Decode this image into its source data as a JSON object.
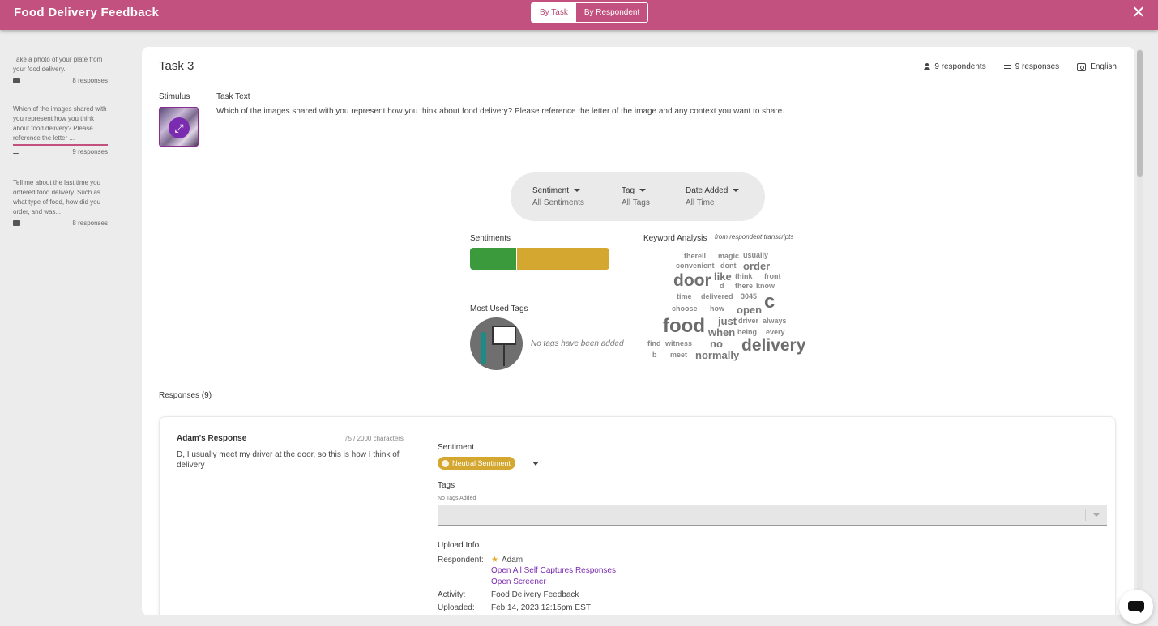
{
  "header": {
    "title": "Food Delivery Feedback",
    "toggle_by_task": "By Task",
    "toggle_by_respondent": "By Respondent",
    "close_icon": "close-icon"
  },
  "sidebar": {
    "items": [
      {
        "question": "Take a photo of your plate from your food delivery.",
        "icon": "camera-icon",
        "responses": "8 responses"
      },
      {
        "question": "Which of the images shared with you represent how you think about food delivery? Please reference the letter ...",
        "icon": "text-lines-icon",
        "responses": "9 responses",
        "active": true
      },
      {
        "question": "Tell me about the last time you ordered food delivery. Such as what type of food, how did you order, and was...",
        "icon": "video-icon",
        "responses": "8 responses"
      }
    ]
  },
  "task": {
    "title": "Task 3",
    "respondents": "9 respondents",
    "responses": "9 responses",
    "language": "English",
    "stimulus_label": "Stimulus",
    "task_text_label": "Task Text",
    "task_text": "Which of the images shared with you represent how you think about food delivery? Please reference the letter of the image and any context you want to share."
  },
  "filters": [
    {
      "label": "Sentiment",
      "value": "All Sentiments"
    },
    {
      "label": "Tag",
      "value": "All Tags"
    },
    {
      "label": "Date Added",
      "value": "All Time"
    }
  ],
  "sentiments": {
    "label": "Sentiments",
    "segments": [
      {
        "name": "positive",
        "fraction": 0.33,
        "color": "#3b9a3b"
      },
      {
        "name": "neutral",
        "fraction": 0.67,
        "color": "#d4a730"
      }
    ]
  },
  "most_used_tags": {
    "label": "Most Used Tags",
    "empty_text": "No tags have been added"
  },
  "keyword_analysis": {
    "label": "Keyword Analysis",
    "sublabel": "from respondent transcripts",
    "words": [
      {
        "text": "therell",
        "size": "small"
      },
      {
        "text": "magic",
        "size": "small"
      },
      {
        "text": "usually",
        "size": "small"
      },
      {
        "text": "convenient",
        "size": "small"
      },
      {
        "text": "dont",
        "size": "small"
      },
      {
        "text": "order",
        "size": "medium"
      },
      {
        "text": "door",
        "size": "large"
      },
      {
        "text": "like",
        "size": "medium"
      },
      {
        "text": "think",
        "size": "small"
      },
      {
        "text": "front",
        "size": "small"
      },
      {
        "text": "d",
        "size": "small"
      },
      {
        "text": "there",
        "size": "small"
      },
      {
        "text": "know",
        "size": "small"
      },
      {
        "text": "time",
        "size": "small"
      },
      {
        "text": "delivered",
        "size": "small"
      },
      {
        "text": "3045",
        "size": "small"
      },
      {
        "text": "c",
        "size": "xlarge"
      },
      {
        "text": "choose",
        "size": "small"
      },
      {
        "text": "how",
        "size": "small"
      },
      {
        "text": "open",
        "size": "medium"
      },
      {
        "text": "food",
        "size": "xlarge"
      },
      {
        "text": "just",
        "size": "medium"
      },
      {
        "text": "driver",
        "size": "small"
      },
      {
        "text": "always",
        "size": "small"
      },
      {
        "text": "when",
        "size": "medium"
      },
      {
        "text": "being",
        "size": "small"
      },
      {
        "text": "every",
        "size": "small"
      },
      {
        "text": "find",
        "size": "small"
      },
      {
        "text": "witness",
        "size": "small"
      },
      {
        "text": "no",
        "size": "medium"
      },
      {
        "text": "delivery",
        "size": "large"
      },
      {
        "text": "b",
        "size": "small"
      },
      {
        "text": "meet",
        "size": "small"
      },
      {
        "text": "normally",
        "size": "medium"
      }
    ]
  },
  "responses": {
    "heading": "Responses (9)",
    "items": [
      {
        "name": "Adam's Response",
        "chars": "75 / 2000 characters",
        "text": "D, I usually meet my driver at the door, so this is how I think of delivery",
        "sentiment_label": "Sentiment",
        "sentiment": "Neutral Sentiment",
        "tags_label": "Tags",
        "no_tags": "No Tags Added",
        "upload_label": "Upload Info",
        "respondent_key": "Respondent:",
        "respondent": "Adam",
        "link_self_captures": "Open All Self Captures Responses",
        "link_screener": "Open Screener",
        "activity_key": "Activity:",
        "activity": "Food Delivery Feedback",
        "uploaded_key": "Uploaded:",
        "uploaded": "Feb 14, 2023 12:15pm EST"
      }
    ]
  },
  "chat_icon": "chat-bubble-icon"
}
